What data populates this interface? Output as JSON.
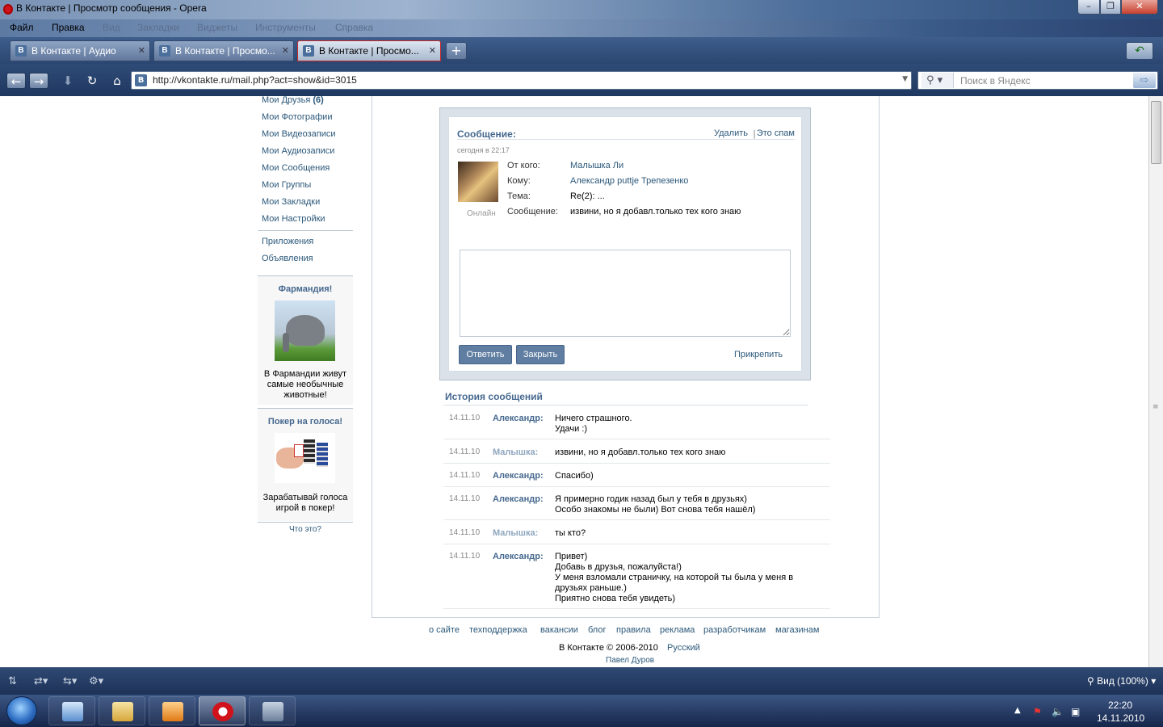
{
  "window": {
    "title": "В Контакте | Просмотр сообщения - Opera",
    "min": "–",
    "max": "❐",
    "close": "✕"
  },
  "menu": {
    "items": [
      "Файл",
      "Правка",
      "Вид",
      "Закладки",
      "Виджеты",
      "Инструменты",
      "Справка"
    ]
  },
  "tabs": [
    {
      "label": "В Контакте | Аудио",
      "icon": "vk-favicon"
    },
    {
      "label": "В Контакте | Просмо...",
      "icon": "vk-favicon"
    },
    {
      "label": "В Контакте | Просмо...",
      "icon": "vk-favicon",
      "active": true
    }
  ],
  "toolbar": {
    "url": "http://vkontakte.ru/mail.php?act=show&id=3015",
    "search_placeholder": "Поиск в Яндекс"
  },
  "sidebar": {
    "links": [
      {
        "label": "Мои Друзья",
        "count": "(6)"
      },
      {
        "label": "Мои Фотографии"
      },
      {
        "label": "Мои Видеозаписи"
      },
      {
        "label": "Мои Аудиозаписи"
      },
      {
        "label": "Мои Сообщения"
      },
      {
        "label": "Мои Группы"
      },
      {
        "label": "Мои Закладки"
      },
      {
        "label": "Мои Настройки"
      }
    ],
    "extra": [
      {
        "label": "Приложения"
      },
      {
        "label": "Объявления"
      }
    ],
    "ads": [
      {
        "title": "Фармандия!",
        "text": "В Фармандии живут самые необычные животные!"
      },
      {
        "title": "Покер на голоса!",
        "text": "Зарабатывай голоса игрой в покер!"
      }
    ],
    "whats_this": "Что это?"
  },
  "message": {
    "title": "Сообщение:",
    "delete": "Удалить",
    "separator": "|",
    "spam": "Это спам",
    "time": "сегодня в 22:17",
    "online": "Онлайн",
    "fields": [
      {
        "label": "От кого:",
        "value": "Малышка Ли",
        "link": true
      },
      {
        "label": "Кому:",
        "value": "Александр puttje Трепезенко",
        "link": true
      },
      {
        "label": "Тема:",
        "value": "Re(2): ...",
        "link": false
      },
      {
        "label": "Сообщение:",
        "value": "извини, но я добавл.только тех кого знаю",
        "link": false
      }
    ],
    "reply_button": "Ответить",
    "close_button": "Закрыть",
    "attach": "Прикрепить"
  },
  "history": {
    "title": "История сообщений",
    "rows": [
      {
        "date": "14.11.10",
        "name": "Александр:",
        "text": "Ничего страшного.\nУдачи :)",
        "self": false
      },
      {
        "date": "14.11.10",
        "name": "Малышка:",
        "text": "извини, но я добавл.только тех кого знаю",
        "self": true
      },
      {
        "date": "14.11.10",
        "name": "Александр:",
        "text": "Спасибо)",
        "self": false
      },
      {
        "date": "14.11.10",
        "name": "Александр:",
        "text": "Я примерно годик назад был у тебя в друзьях)\nОсобо знакомы не были) Вот снова тебя нашёл)",
        "self": false
      },
      {
        "date": "14.11.10",
        "name": "Малышка:",
        "text": "ты кто?",
        "self": true
      },
      {
        "date": "14.11.10",
        "name": "Александр:",
        "text": "Привет)\nДобавь в друзья, пожалуйста!)\nУ меня взломали страничку, на которой ты была у меня в друзьях раньше.)\nПриятно снова тебя увидеть)",
        "self": false
      }
    ]
  },
  "footer": {
    "links": [
      "о сайте",
      "техподдержка",
      "вакансии",
      "блог",
      "правила",
      "реклама",
      "разработчикам",
      "магазинам"
    ],
    "copyright": "В Контакте © 2006-2010",
    "language": "Русский",
    "author": "Павел Дуров"
  },
  "statusbar": {
    "zoom": "Вид (100%)"
  },
  "taskbar": {
    "time": "22:20",
    "date": "14.11.2010"
  },
  "colors": {
    "vk_link": "#2b587a",
    "vk_header": "#45688e",
    "vk_button": "#5f7ea1"
  }
}
